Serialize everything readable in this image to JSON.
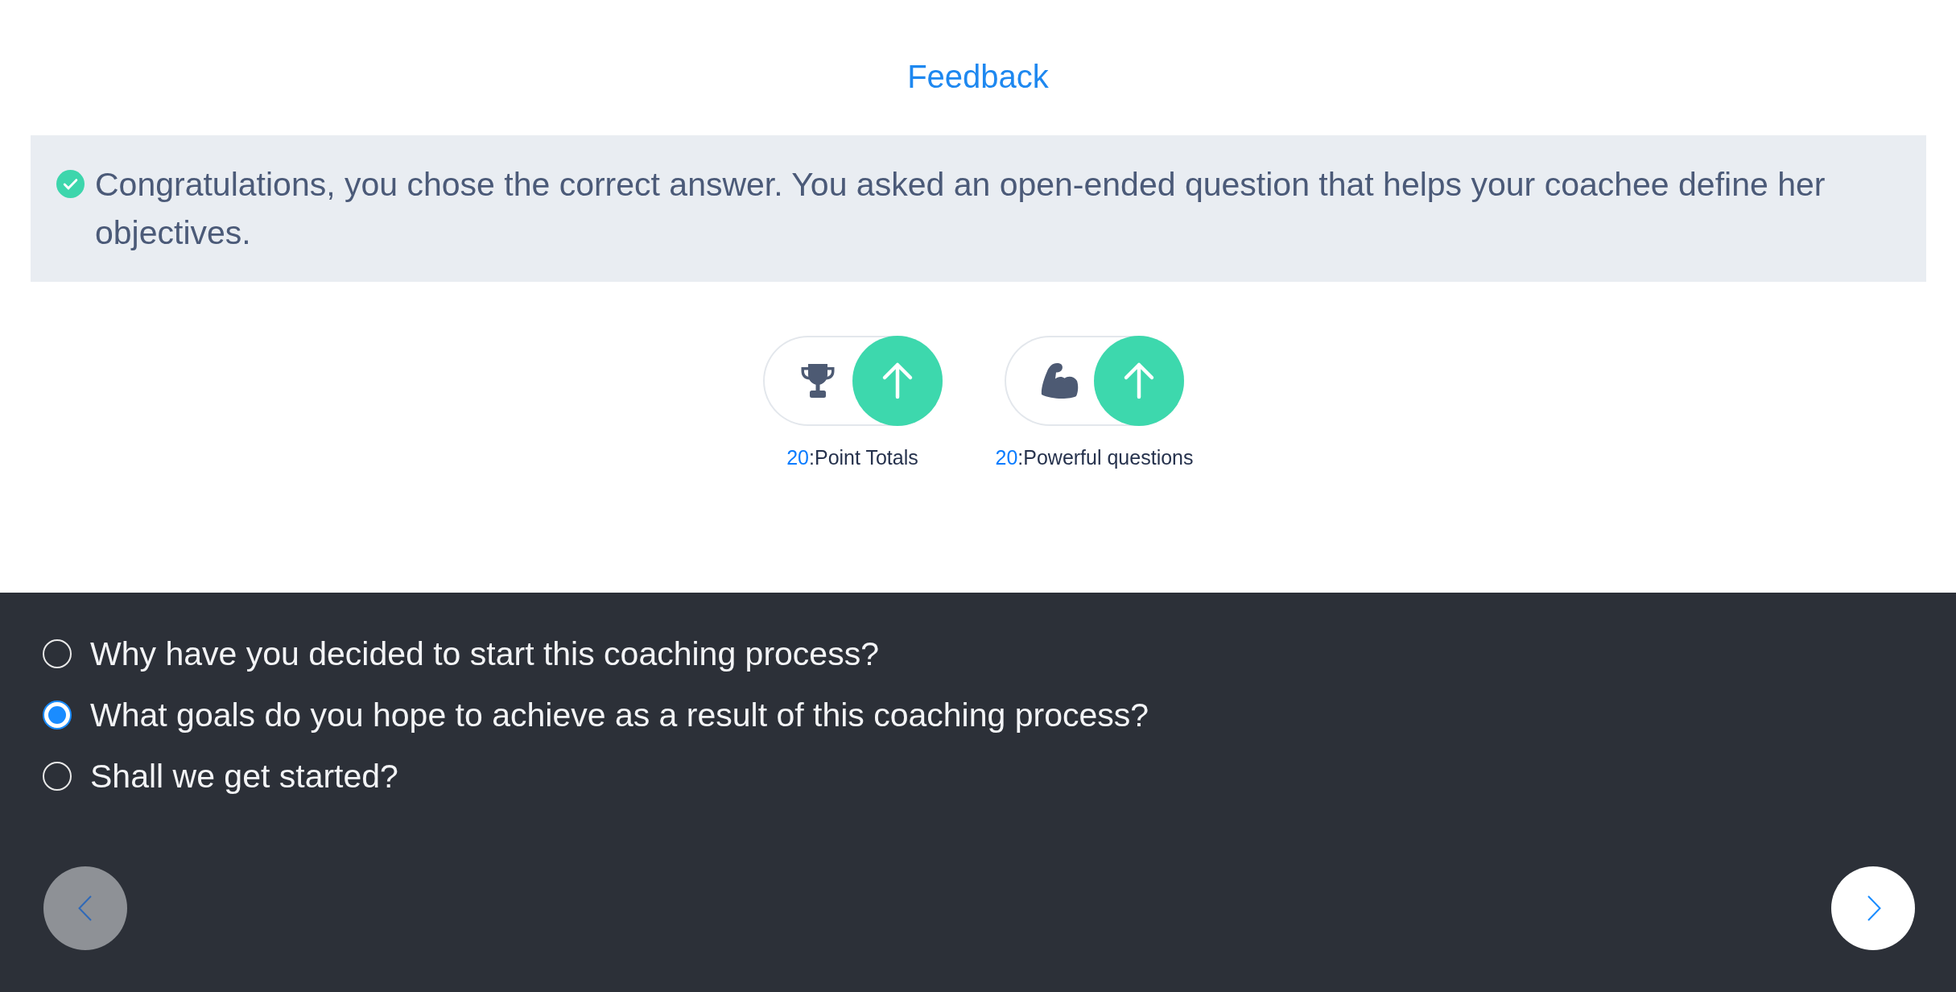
{
  "feedback": {
    "title": "Feedback",
    "correct": true,
    "message": "Congratulations, you chose the correct answer. You asked an open-ended question that helps your coachee define her objectives."
  },
  "badges": [
    {
      "kind": "trophy",
      "increased": true,
      "count": "20",
      "label": ":Point Totals"
    },
    {
      "kind": "muscle",
      "increased": true,
      "count": "20",
      "label": ":Powerful questions"
    }
  ],
  "options": [
    {
      "label": "Why have you decided to start this coaching process?",
      "selected": false
    },
    {
      "label": "What goals do you hope to achieve as a result of this coaching process?",
      "selected": true
    },
    {
      "label": "Shall we get started?",
      "selected": false
    }
  ],
  "navigation": {
    "previous": {
      "disabled": true
    },
    "next": {
      "disabled": false
    }
  }
}
